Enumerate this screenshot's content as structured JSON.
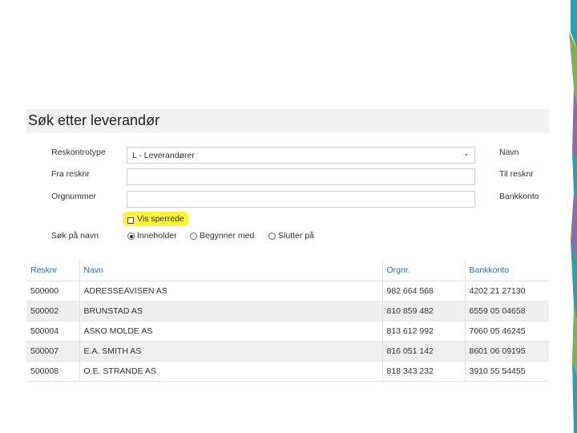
{
  "page_title": "Søk etter leverandør",
  "form": {
    "reskontrotype_label": "Reskontrotype",
    "reskontrotype_value": "L - Leverandører",
    "fra_resknr_label": "Fra resknr",
    "orgnummer_label": "Orgnummer",
    "navn_label": "Navn",
    "til_resknr_label": "Til resknr",
    "bankkonto_label": "Bankkonto",
    "vis_sperrede_label": "Vis sperrede",
    "sok_pa_navn_label": "Søk på navn",
    "radio_options": [
      "Inneholder",
      "Begynner med",
      "Slutter på"
    ],
    "radio_selected": "Inneholder"
  },
  "table": {
    "headers": [
      "Resknr",
      "Navn",
      "Orgnr.",
      "Bankkonto"
    ],
    "rows": [
      [
        "500000",
        "ADRESSEAVISEN AS",
        "982 664 568",
        "4202 21 27130"
      ],
      [
        "500002",
        "BRUNSTAD AS",
        "810 859 482",
        "6559 05 04658"
      ],
      [
        "500004",
        "ASKO MOLDE AS",
        "813 612 992",
        "7060 05 46245"
      ],
      [
        "500007",
        "E.A. SMITH AS",
        "816 051 142",
        "8601 06 09195"
      ],
      [
        "500008",
        "O.E. STRANDE AS",
        "818 343 232",
        "3910 55 54455"
      ]
    ]
  },
  "colors": {
    "highlight": "#fff33a",
    "header_text": "#2a6fb0",
    "accent_teal": "#1aa6b7",
    "accent_purple": "#8b6bb1",
    "accent_green": "#7ab648"
  }
}
